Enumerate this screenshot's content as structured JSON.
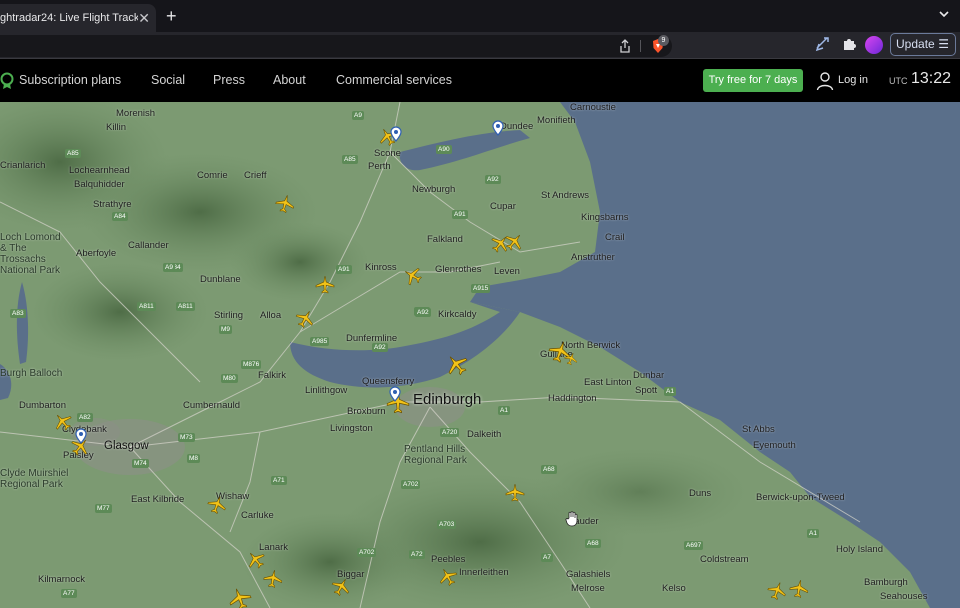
{
  "browser": {
    "tab_title": "ghtradar24: Live Flight Tracke",
    "tab_close": "✕",
    "new_tab": "+",
    "brave_badge": "9",
    "update_label": "Update",
    "menu_glyph": "☰"
  },
  "nav": {
    "items": [
      "Subscription plans",
      "Social",
      "Press",
      "About",
      "Commercial services"
    ],
    "trial_label": "Try free for 7 days",
    "login_label": "Log in",
    "utc_label": "UTC",
    "time": "13:22"
  },
  "map": {
    "places": [
      {
        "name": "Morenish",
        "kind": "label"
      },
      {
        "name": "Killin",
        "kind": "label"
      },
      {
        "name": "Crianlarich",
        "kind": "label"
      },
      {
        "name": "Lochearnhead",
        "kind": "label"
      },
      {
        "name": "Balquhidder",
        "kind": "label"
      },
      {
        "name": "Strathyre",
        "kind": "label"
      },
      {
        "name": "Comrie",
        "kind": "label"
      },
      {
        "name": "Crieff",
        "kind": "label"
      },
      {
        "name": "Callander",
        "kind": "label"
      },
      {
        "name": "Aberfoyle",
        "kind": "label"
      },
      {
        "name": "Dunblane",
        "kind": "label"
      },
      {
        "name": "Stirling",
        "kind": "label"
      },
      {
        "name": "Alloa",
        "kind": "label"
      },
      {
        "name": "Falkirk",
        "kind": "label"
      },
      {
        "name": "Linlithgow",
        "kind": "label"
      },
      {
        "name": "Cumbernauld",
        "kind": "label"
      },
      {
        "name": "Dumbarton",
        "kind": "label"
      },
      {
        "name": "Clydebank",
        "kind": "label"
      },
      {
        "name": "Paisley",
        "kind": "label"
      },
      {
        "name": "Glasgow",
        "kind": "city"
      },
      {
        "name": "East Kilbride",
        "kind": "label"
      },
      {
        "name": "Wishaw",
        "kind": "label"
      },
      {
        "name": "Carluke",
        "kind": "label"
      },
      {
        "name": "Lanark",
        "kind": "label"
      },
      {
        "name": "Kilmarnock",
        "kind": "label"
      },
      {
        "name": "Scone",
        "kind": "label"
      },
      {
        "name": "Perth",
        "kind": "label"
      },
      {
        "name": "Newburgh",
        "kind": "label"
      },
      {
        "name": "Cupar",
        "kind": "label"
      },
      {
        "name": "St Andrews",
        "kind": "label"
      },
      {
        "name": "Kingsbarns",
        "kind": "label"
      },
      {
        "name": "Crail",
        "kind": "label"
      },
      {
        "name": "Anstruther",
        "kind": "label"
      },
      {
        "name": "Falkland",
        "kind": "label"
      },
      {
        "name": "Kinross",
        "kind": "label"
      },
      {
        "name": "Glenrothes",
        "kind": "label"
      },
      {
        "name": "Leven",
        "kind": "label"
      },
      {
        "name": "Kirkcaldy",
        "kind": "label"
      },
      {
        "name": "Dunfermline",
        "kind": "label"
      },
      {
        "name": "Queensferry",
        "kind": "label"
      },
      {
        "name": "Broxburn",
        "kind": "label"
      },
      {
        "name": "Livingston",
        "kind": "label"
      },
      {
        "name": "Edinburgh",
        "kind": "big"
      },
      {
        "name": "Dalkeith",
        "kind": "label"
      },
      {
        "name": "Dundee",
        "kind": "label"
      },
      {
        "name": "Monifieth",
        "kind": "label"
      },
      {
        "name": "Carnoustie",
        "kind": "label"
      },
      {
        "name": "North Berwick",
        "kind": "label"
      },
      {
        "name": "Gullane",
        "kind": "label"
      },
      {
        "name": "East Linton",
        "kind": "label"
      },
      {
        "name": "Dunbar",
        "kind": "label"
      },
      {
        "name": "Spott",
        "kind": "label"
      },
      {
        "name": "Haddington",
        "kind": "label"
      },
      {
        "name": "St Abbs",
        "kind": "label"
      },
      {
        "name": "Eyemouth",
        "kind": "label"
      },
      {
        "name": "Duns",
        "kind": "label"
      },
      {
        "name": "Berwick-upon-Tweed",
        "kind": "label"
      },
      {
        "name": "Holy Island",
        "kind": "label"
      },
      {
        "name": "Coldstream",
        "kind": "label"
      },
      {
        "name": "Kelso",
        "kind": "label"
      },
      {
        "name": "Melrose",
        "kind": "label"
      },
      {
        "name": "Galashiels",
        "kind": "label"
      },
      {
        "name": "Innerleithen",
        "kind": "label"
      },
      {
        "name": "Peebles",
        "kind": "label"
      },
      {
        "name": "Biggar",
        "kind": "label"
      },
      {
        "name": "Bamburgh",
        "kind": "label"
      },
      {
        "name": "Seahouses",
        "kind": "label"
      },
      {
        "name": "Lauder",
        "kind": "label"
      }
    ],
    "regions": [
      "Loch Lomond & The Trossachs National Park",
      "Pentland Hills Regional Park",
      "Clyde Muirshiel Regional Park",
      "Burgh Balloch"
    ],
    "roads": [
      "A9",
      "A85",
      "A85",
      "A84",
      "A811",
      "A811",
      "A84",
      "A9",
      "A91",
      "A92",
      "A915",
      "A92",
      "A91",
      "A90",
      "A92",
      "A985",
      "M9",
      "M876",
      "M80",
      "M73",
      "M8",
      "M74",
      "M77",
      "A71",
      "A702",
      "A702",
      "A72",
      "A703",
      "A7",
      "A68",
      "A68",
      "A697",
      "A1",
      "A1",
      "A1",
      "A720",
      "A82",
      "A77",
      "A92",
      "A83"
    ]
  }
}
